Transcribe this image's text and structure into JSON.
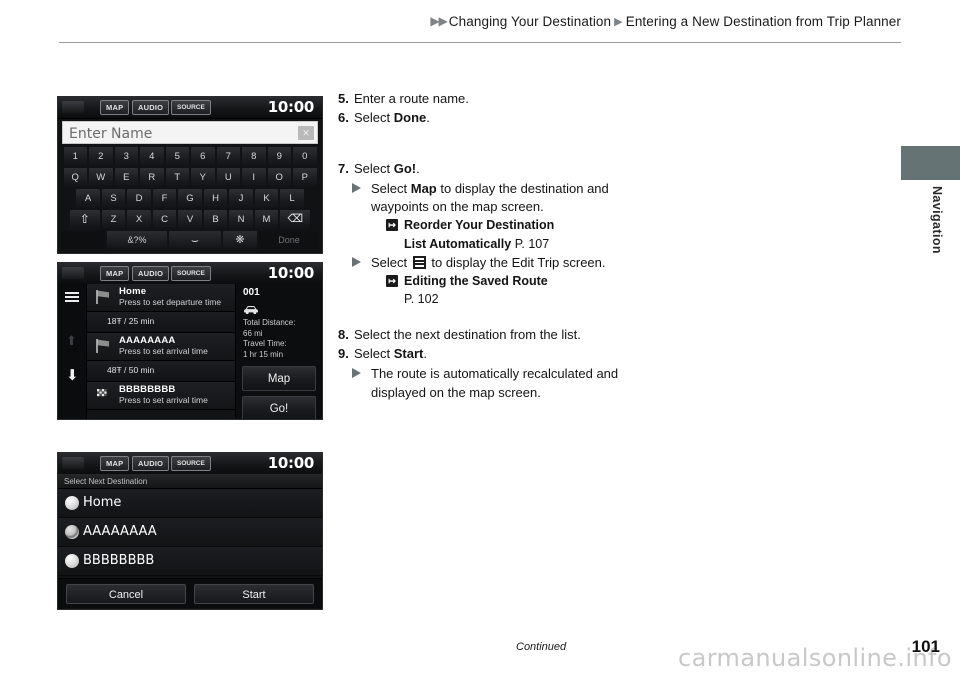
{
  "header": {
    "arrow_pair": "▶▶",
    "separator": "▶",
    "crumb1": "Changing Your Destination",
    "crumb2": "Entering a New Destination from Trip Planner"
  },
  "side_tab": {
    "label": "Navigation",
    "color": "#657374"
  },
  "screen1": {
    "statusbar": {
      "map": "MAP",
      "audio": "AUDIO",
      "source": "SOURCE",
      "clock": "10:00"
    },
    "field": {
      "placeholder": "Enter Name",
      "clear_icon": "✕"
    },
    "keyboard": {
      "row_numbers": [
        "1",
        "2",
        "3",
        "4",
        "5",
        "6",
        "7",
        "8",
        "9",
        "0"
      ],
      "row_top": [
        "Q",
        "W",
        "E",
        "R",
        "T",
        "Y",
        "U",
        "I",
        "O",
        "P"
      ],
      "row_home": [
        "A",
        "S",
        "D",
        "F",
        "G",
        "H",
        "J",
        "K",
        "L"
      ],
      "row_bottom_letters": [
        "Z",
        "X",
        "C",
        "V",
        "B",
        "N",
        "M"
      ],
      "shift_icon": "⇧",
      "backspace_icon": "⌫",
      "symbols_label": "&?%",
      "space_label": "⌣",
      "language_icon": "❋",
      "done_label": "Done"
    }
  },
  "screen2": {
    "statusbar": {
      "map": "MAP",
      "audio": "AUDIO",
      "source": "SOURCE",
      "clock": "10:00"
    },
    "menu_icon": "hamburger-icon",
    "scroll_up_icon": "⬆",
    "scroll_down_icon": "⬇",
    "items": [
      {
        "title": "Home",
        "sub": "Press to set departure time",
        "icon": "flag-icon"
      },
      {
        "title": "AAAAAAAA",
        "sub": "Press to set arrival time",
        "icon": "flag-icon"
      },
      {
        "title": "BBBBBBBB",
        "sub": "Press to set arrival time",
        "icon": "checkered-flag-icon"
      }
    ],
    "legs": [
      "18Ŧ / 25 min",
      "48Ŧ / 50 min"
    ],
    "route_number": "001",
    "car_icon": "🚗",
    "total_distance_label": "Total Distance:",
    "total_distance_value": "66 mi",
    "travel_time_label": "Travel Time:",
    "travel_time_value": "1 hr 15 min",
    "map_button": "Map",
    "go_button": "Go!"
  },
  "screen3": {
    "statusbar": {
      "map": "MAP",
      "audio": "AUDIO",
      "source": "SOURCE",
      "clock": "10:00"
    },
    "title": "Select Next Destination",
    "options": [
      "Home",
      "AAAAAAAA",
      "BBBBBBBB"
    ],
    "cancel_button": "Cancel",
    "start_button": "Start"
  },
  "steps": {
    "s5_num": "5.",
    "s5_text": "Enter a route name.",
    "s6_num": "6.",
    "s6_pre": "Select ",
    "s6_bold": "Done",
    "s6_post": ".",
    "s7_num": "7.",
    "s7_pre": "Select ",
    "s7_bold": "Go!",
    "s7_post": ".",
    "b1_pre": "Select ",
    "b1_bold": "Map",
    "b1_post": " to display the destination and waypoints on the map screen.",
    "ref1_icon": "↦",
    "ref1_line1": "Reorder Your Destination",
    "ref1_line2": "List Automatically",
    "ref1_page": "P. 107",
    "b2_pre": "Select ",
    "b2_post": " to display the Edit Trip screen.",
    "ref2_icon": "↦",
    "ref2_line1": "Editing the Saved Route",
    "ref2_page": "P. 102",
    "s8_num": "8.",
    "s8_text": "Select the next destination from the list.",
    "s9_num": "9.",
    "s9_pre": "Select ",
    "s9_bold": "Start",
    "s9_post": ".",
    "b3_text": "The route is automatically recalculated and displayed on the map screen."
  },
  "footer": {
    "continued": "Continued",
    "page_number": "101",
    "watermark": "carmanualsonline.info"
  }
}
